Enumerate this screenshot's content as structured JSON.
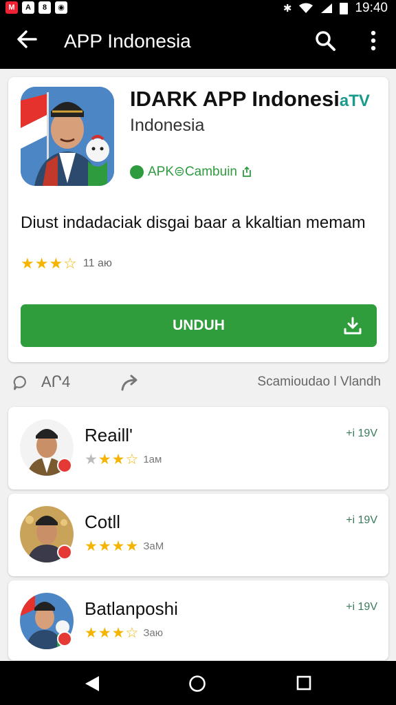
{
  "status_bar": {
    "left_icons": [
      "red-app-icon",
      "notification-icon",
      "notification-icon",
      "notification-icon"
    ],
    "right_icons": [
      "bluetooth-icon",
      "wifi-icon",
      "signal-icon",
      "battery-icon"
    ],
    "time": "19:40"
  },
  "app_bar": {
    "title": "APP Indonesia",
    "icons": [
      "back-arrow-icon",
      "search-icon",
      "more-vert-icon"
    ]
  },
  "app": {
    "name": "IDARK APP Indonesi",
    "name_tag": "aTV",
    "country": "Indonesia",
    "apk_label": "APK⊜Cambuin",
    "description": "Diust indadaciak disgai baar a kkaltian memam",
    "rating_count": "11 aю",
    "rating": 3.5,
    "download_label": "UNDUH"
  },
  "actions": {
    "comment_label": "AՐ4",
    "right_text": "Scamioudao l Vlandh"
  },
  "reviews": [
    {
      "name": "Reaill'",
      "time": "1ам",
      "version": "+i 19V",
      "rating": 2.5
    },
    {
      "name": "Cotll",
      "time": "ЗаМ",
      "version": "+i 19V",
      "rating": 4
    },
    {
      "name": "Batlanposhi",
      "time": "Заю",
      "version": "+i 19V",
      "rating": 3.5
    }
  ],
  "colors": {
    "accent_green": "#2f9d3c",
    "star_gold": "#f4b400",
    "bar_black": "#000000",
    "badge_red": "#e53935"
  },
  "navigation": {
    "buttons": [
      "nav-back-icon",
      "nav-home-icon",
      "nav-recent-icon"
    ]
  }
}
